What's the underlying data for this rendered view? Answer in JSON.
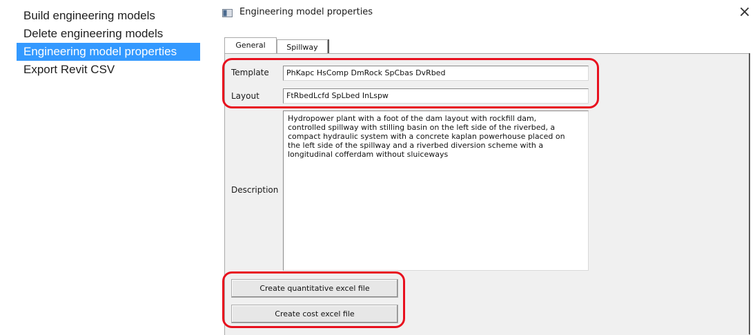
{
  "menu": {
    "items": [
      {
        "label": "Build engineering models",
        "selected": false
      },
      {
        "label": "Delete engineering models",
        "selected": false
      },
      {
        "label": "Engineering model properties",
        "selected": true
      },
      {
        "label": "Export Revit CSV",
        "selected": false
      }
    ]
  },
  "dialog": {
    "title": "Engineering model properties",
    "close_glyph": "×",
    "tabs": [
      {
        "label": "General",
        "active": true
      },
      {
        "label": "Spillway",
        "active": false
      }
    ],
    "fields": {
      "template_label": "Template",
      "template_value": "PhKapc HsComp DmRock SpCbas DvRbed",
      "layout_label": "Layout",
      "layout_value": "FtRbedLcfd SpLbed InLspw",
      "description_label": "Description",
      "description_value": "Hydropower plant with a foot of the dam layout with rockfill dam,\ncontrolled spillway with stilling basin on the left side of the riverbed, a\ncompact hydraulic system with a concrete kaplan powerhouse placed on\nthe left side of the spillway and a riverbed diversion scheme with a\nlongitudinal cofferdam without sluiceways"
    },
    "buttons": {
      "quantitative": "Create quantitative excel file",
      "cost": "Create cost excel file"
    }
  },
  "colors": {
    "selection": "#3399ff",
    "highlight": "#e8101e",
    "panel": "#f0f0f0"
  }
}
